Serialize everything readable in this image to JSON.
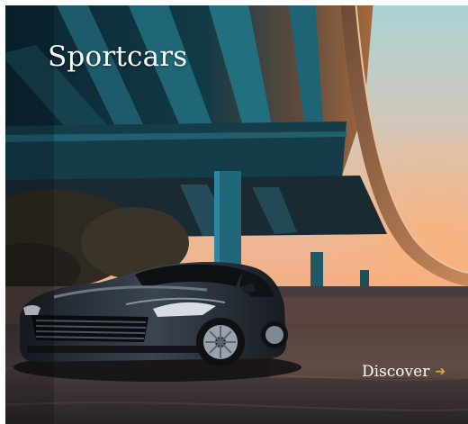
{
  "card": {
    "title": "Sportcars",
    "link_label": "Discover",
    "link_icon": "arrow-right-icon",
    "accent_color": "#d9a441"
  }
}
